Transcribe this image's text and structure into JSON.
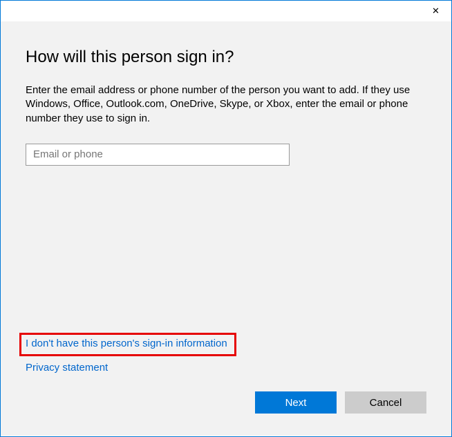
{
  "heading": "How will this person sign in?",
  "description": "Enter the email address or phone number of the person you want to add. If they use Windows, Office, Outlook.com, OneDrive, Skype, or Xbox, enter the email or phone number they use to sign in.",
  "input": {
    "placeholder": "Email or phone",
    "value": ""
  },
  "links": {
    "no_signin_info": "I don't have this person's sign-in information",
    "privacy": "Privacy statement"
  },
  "buttons": {
    "next": "Next",
    "cancel": "Cancel"
  }
}
